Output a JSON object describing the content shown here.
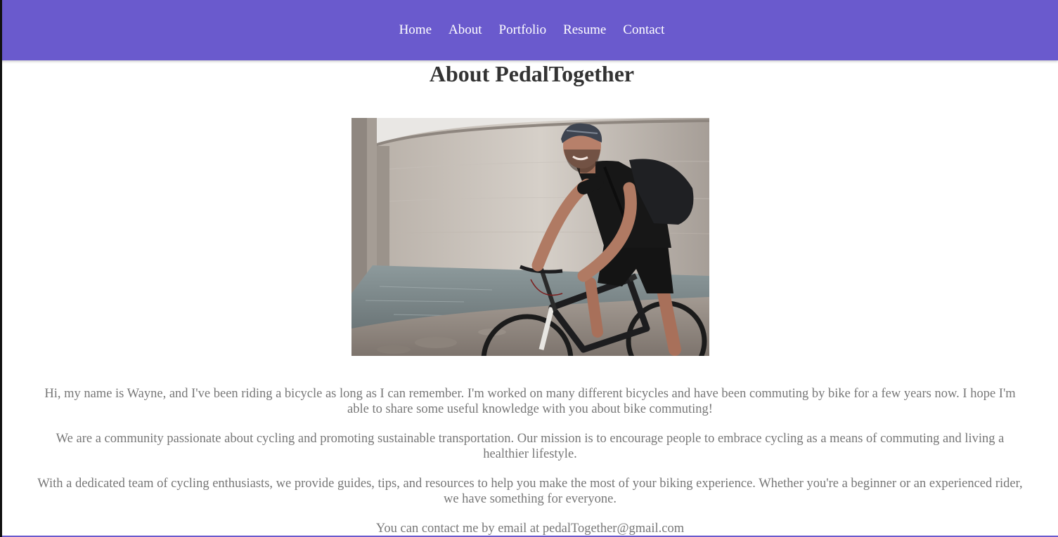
{
  "nav": {
    "items": [
      {
        "label": "Home"
      },
      {
        "label": "About"
      },
      {
        "label": "Portfolio"
      },
      {
        "label": "Resume"
      },
      {
        "label": "Contact"
      }
    ]
  },
  "main": {
    "title": "About PedalTogether",
    "paragraphs": [
      "Hi, my name is Wayne, and I've been riding a bicycle as long as I can remember. I'm worked on many different bicycles and have been commuting by bike for a few years now. I hope I'm able to share some useful knowledge with you about bike commuting!",
      "We are a community passionate about cycling and promoting sustainable transportation. Our mission is to encourage people to embrace cycling as a means of commuting and living a healthier lifestyle.",
      "With a dedicated team of cycling enthusiasts, we provide guides, tips, and resources to help you make the most of your biking experience. Whether you're a beginner or an experienced rider, we have something for everyone.",
      "You can contact me by email at pedalTogether@gmail.com"
    ]
  },
  "colors": {
    "nav_bg": "#6a5acd",
    "title_text": "#333333",
    "body_text": "#777777"
  }
}
